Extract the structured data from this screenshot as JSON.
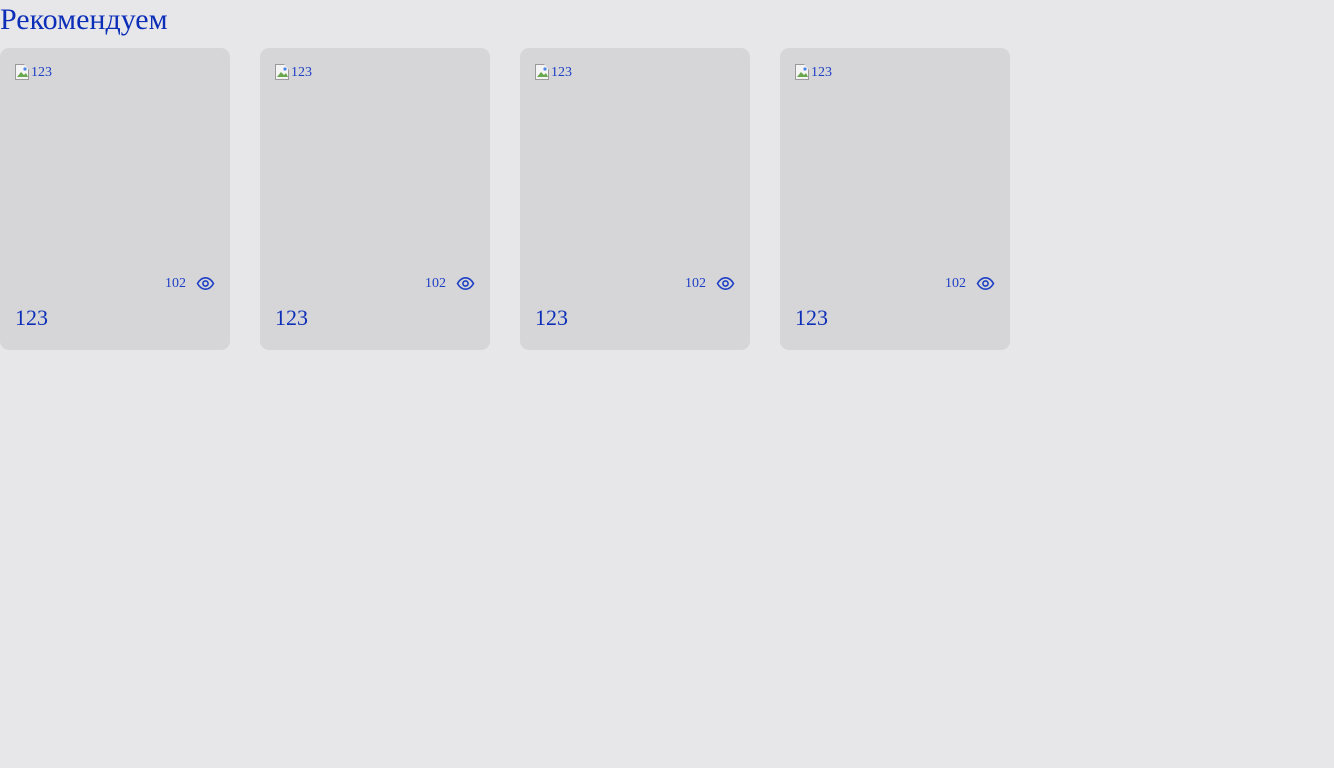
{
  "section": {
    "title": "Рекомендуем"
  },
  "cards": [
    {
      "image_alt": "123",
      "views": "102",
      "title": "123"
    },
    {
      "image_alt": "123",
      "views": "102",
      "title": "123"
    },
    {
      "image_alt": "123",
      "views": "102",
      "title": "123"
    },
    {
      "image_alt": "123",
      "views": "102",
      "title": "123"
    }
  ],
  "colors": {
    "background": "#e7e7ea",
    "card_background": "#d6d6d9",
    "text_accent": "#0d2fb8"
  },
  "icons": {
    "views": "eye-icon",
    "image_placeholder": "broken-image-icon"
  }
}
